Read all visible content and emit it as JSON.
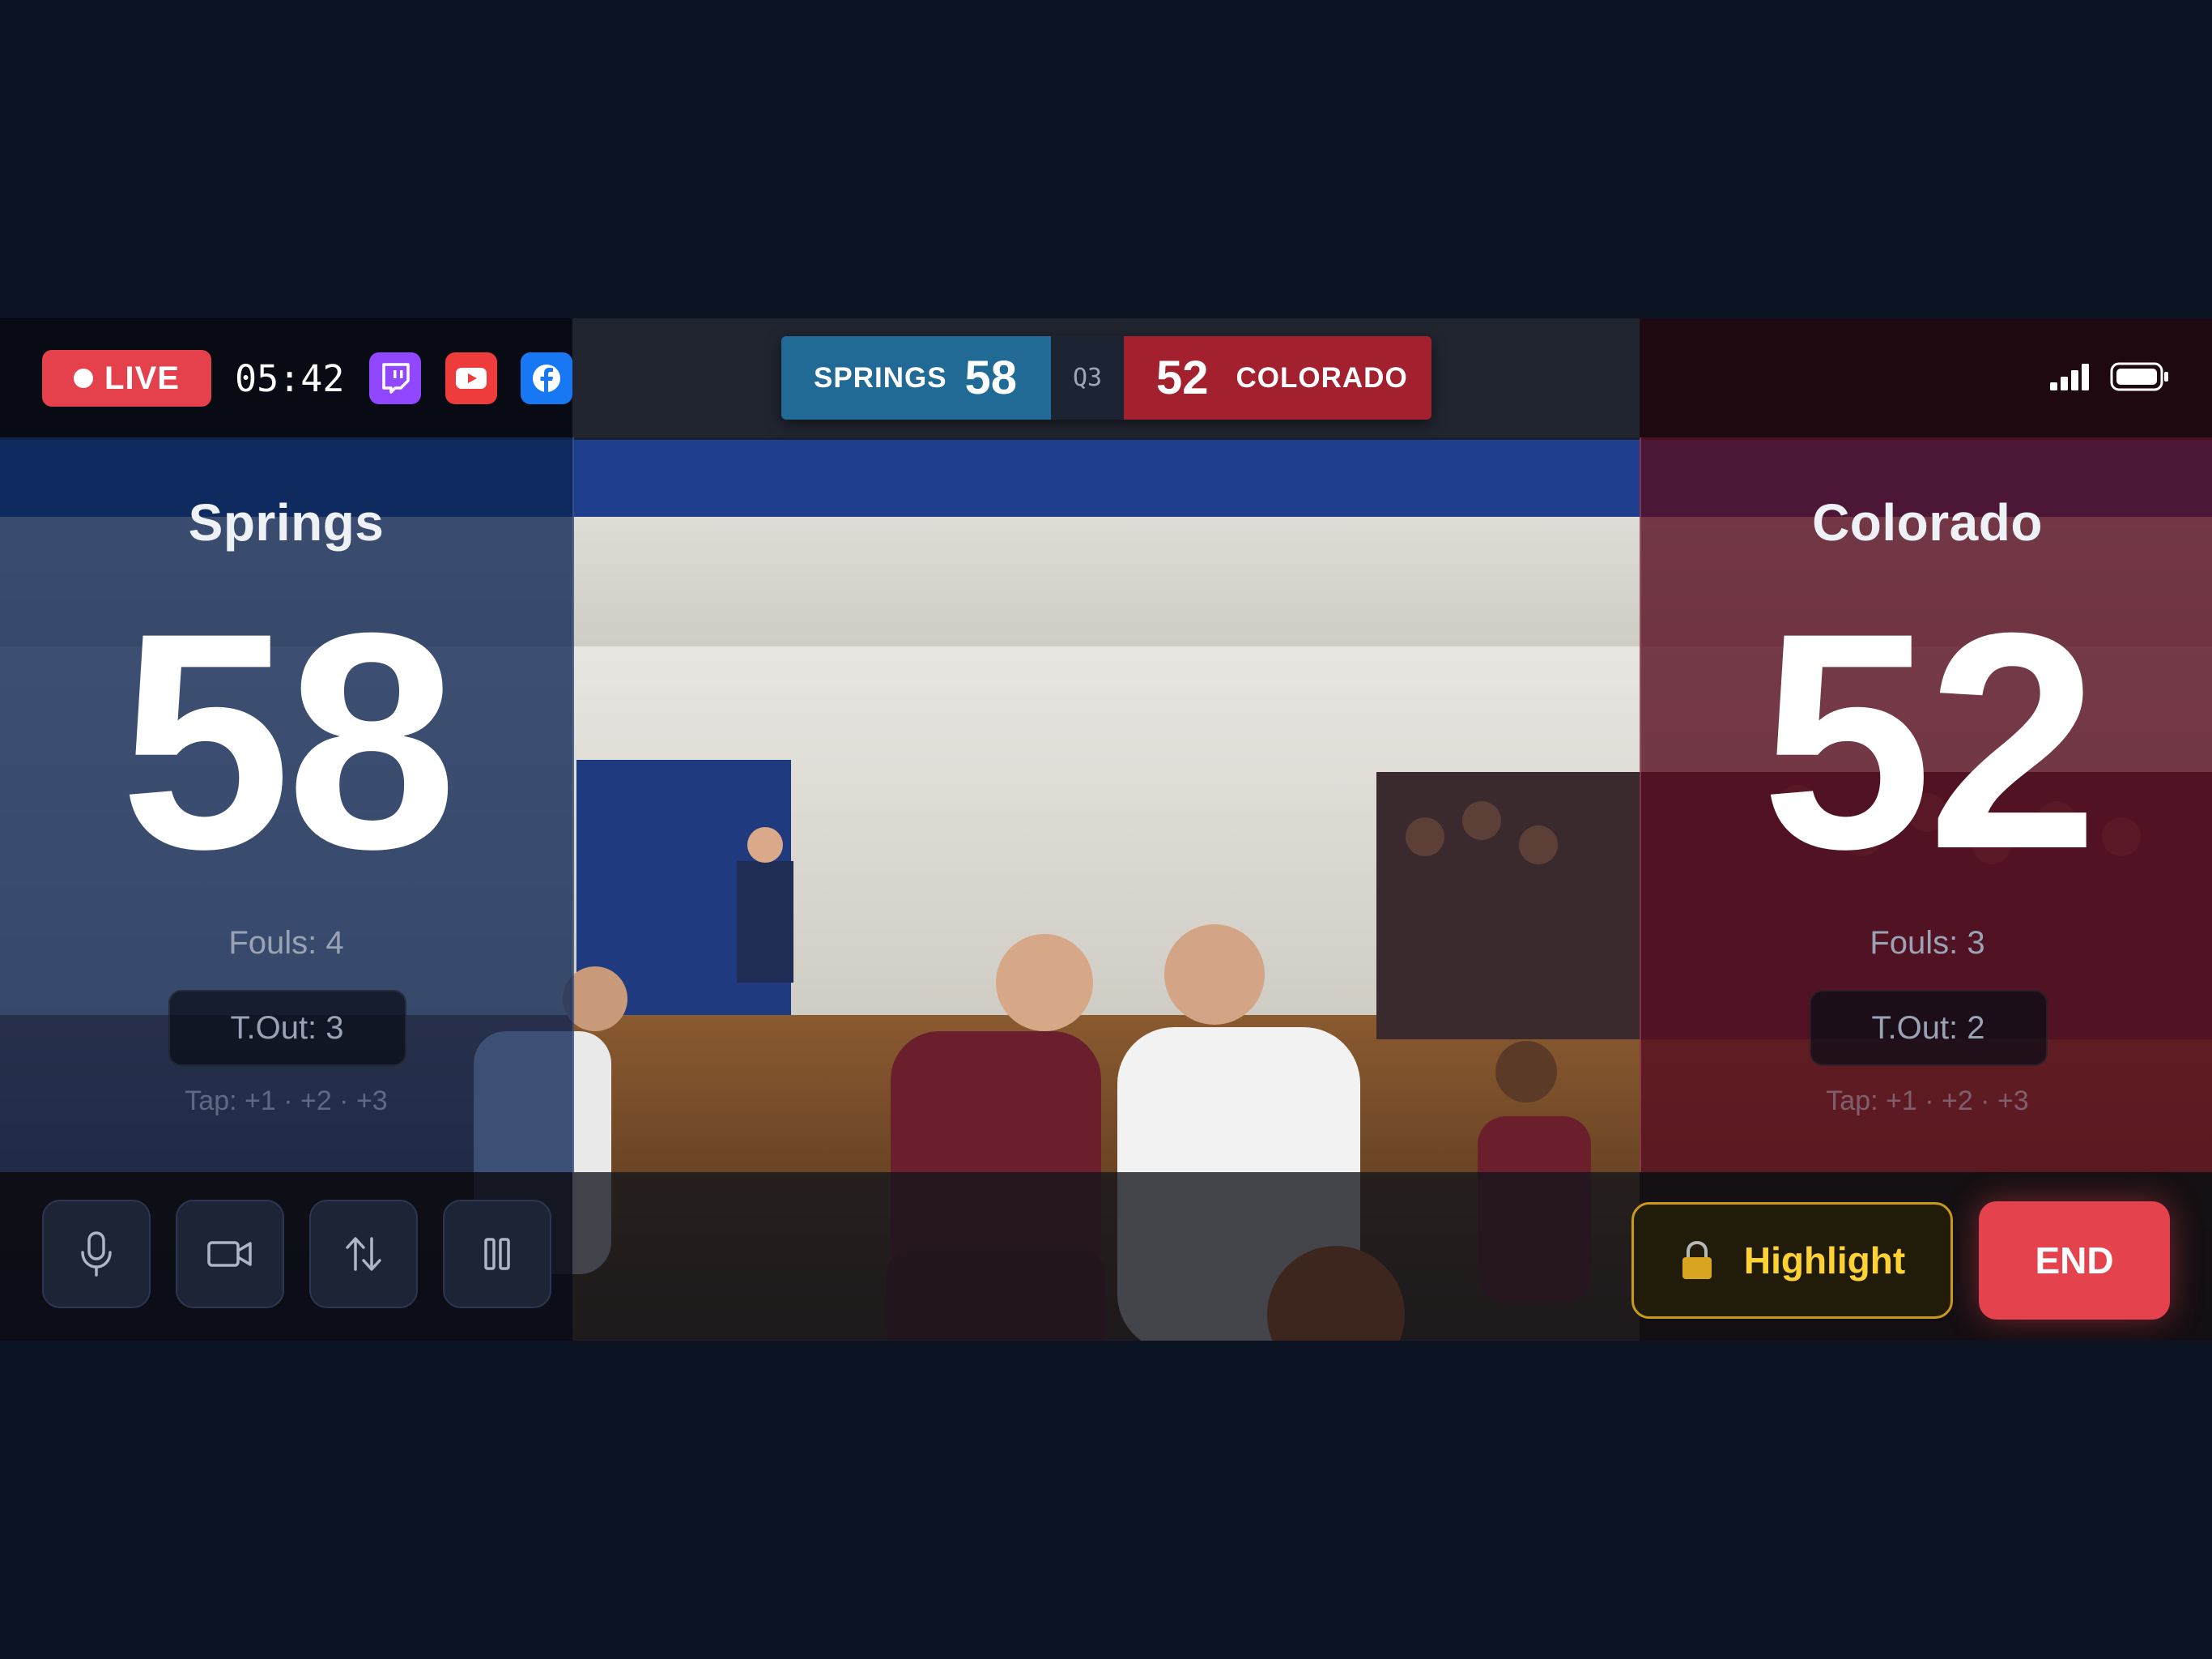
{
  "colors": {
    "background": "#0c1322",
    "live": "#e5414d",
    "home_team": "#206a95",
    "away_team": "#a3202f",
    "highlight": "#ffd233",
    "end": "#e4434d",
    "twitch": "#9146ff",
    "youtube": "#ee3b3b",
    "facebook": "#1877f2"
  },
  "stream": {
    "live_label": "LIVE",
    "elapsed": "05:42",
    "platforms": [
      "twitch-icon",
      "youtube-icon",
      "facebook-icon"
    ]
  },
  "scorebug": {
    "home_name": "SPRINGS",
    "home_score": "58",
    "period": "Q3",
    "away_score": "52",
    "away_name": "COLORADO"
  },
  "status": {
    "icons": [
      "signal-icon",
      "battery-icon"
    ]
  },
  "home": {
    "name": "Springs",
    "score": "58",
    "fouls": "Fouls: 4",
    "timeouts": "T.Out: 3",
    "tap_hint": "Tap: +1 · +2 · +3"
  },
  "away": {
    "name": "Colorado",
    "score": "52",
    "fouls": "Fouls: 3",
    "timeouts": "T.Out: 2",
    "tap_hint": "Tap: +1 · +2 · +3"
  },
  "controls": {
    "buttons": [
      "microphone-icon",
      "camera-icon",
      "swap-icon",
      "pause-icon"
    ],
    "highlight_label": "Highlight",
    "highlight_icon": "lock-icon",
    "end_label": "END"
  }
}
